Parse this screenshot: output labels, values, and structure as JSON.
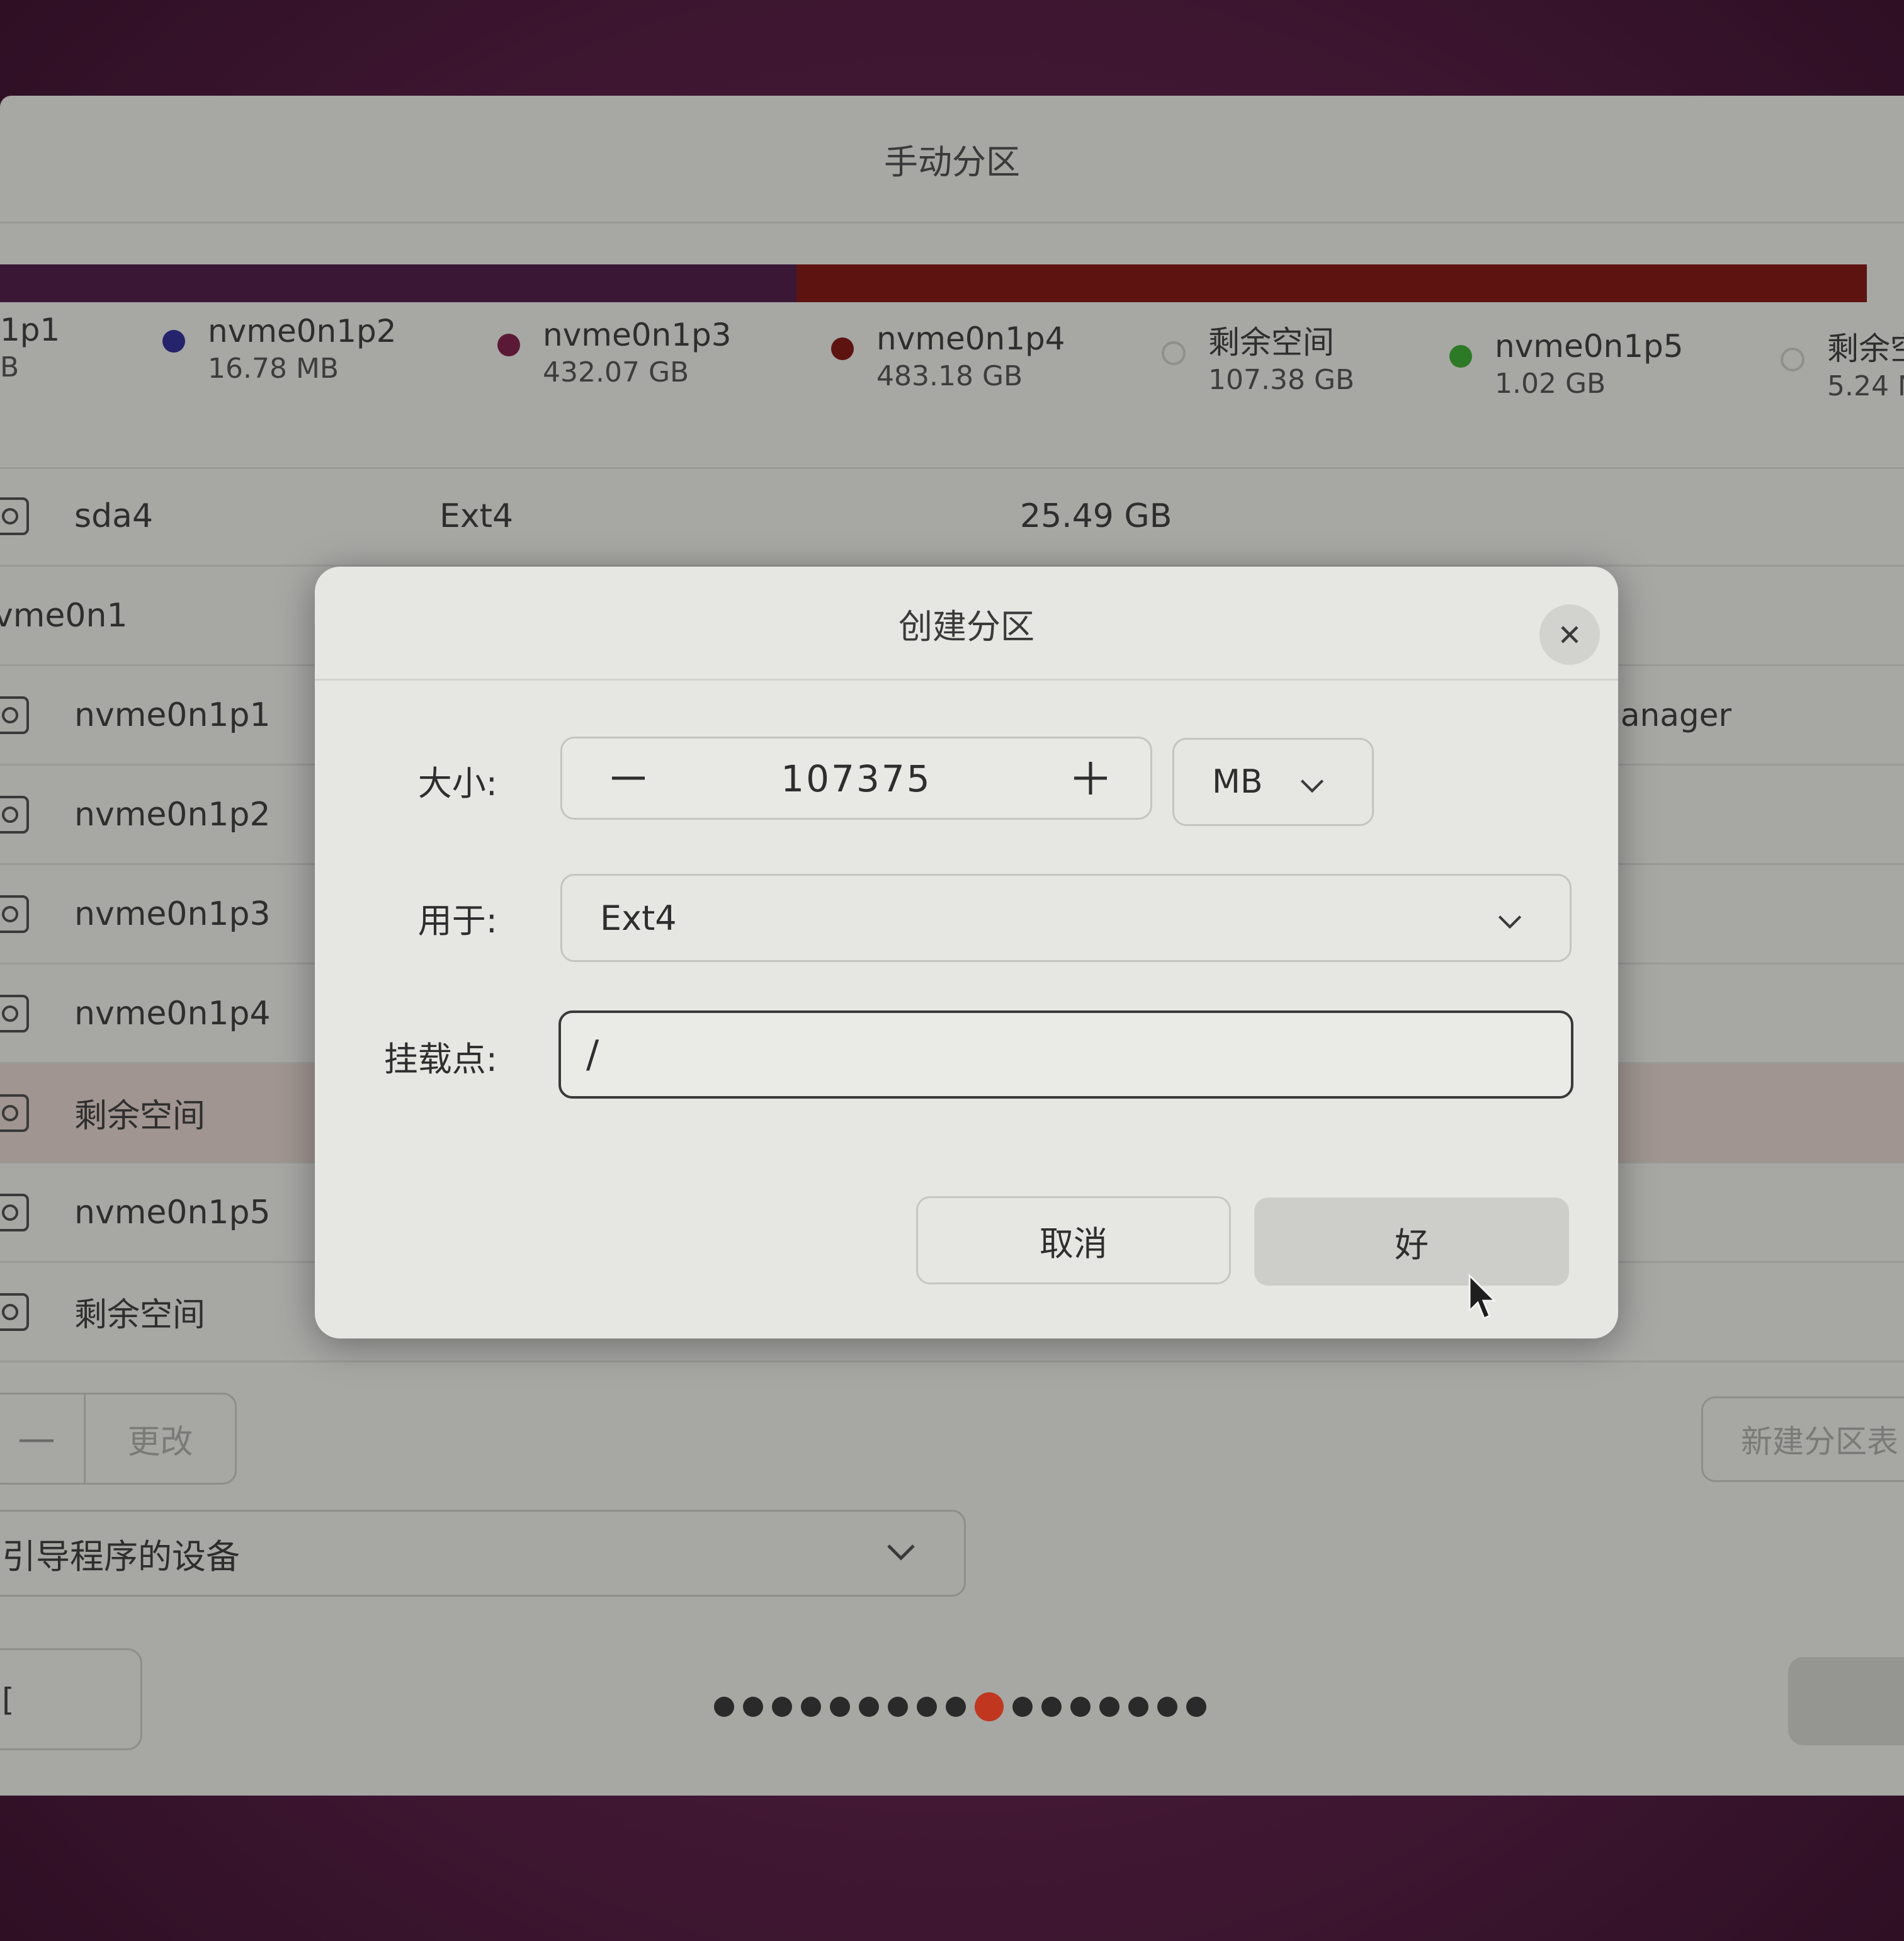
{
  "window": {
    "title": "手动分区",
    "colors": {
      "usage_purple": "#3b1736",
      "usage_red": "#5d1410"
    }
  },
  "legend": [
    {
      "name": "1p1",
      "size": "B",
      "dot_color": "#6b2a3c"
    },
    {
      "name": "nvme0n1p2",
      "size": "16.78 MB",
      "dot_color": "#25236b"
    },
    {
      "name": "nvme0n1p3",
      "size": "432.07 GB",
      "dot_color": "#5a1a36"
    },
    {
      "name": "nvme0n1p4",
      "size": "483.18 GB",
      "dot_color": "#5d1410"
    },
    {
      "name": "剩余空间",
      "size": "107.38 GB",
      "dot_color": "hollow"
    },
    {
      "name": "nvme0n1p5",
      "size": "1.02 GB",
      "dot_color": "#2d7a26"
    },
    {
      "name": "剩余空",
      "size": "5.24 M",
      "dot_color": "hollow"
    }
  ],
  "rows": [
    {
      "name": "sda4",
      "fs": "Ext4",
      "size": "25.49 GB",
      "extra": ""
    },
    {
      "name": "vme0n1",
      "fs": "",
      "size": "",
      "extra": ""
    },
    {
      "name": "nvme0n1p1",
      "fs": "",
      "size": "",
      "extra": "lanager"
    },
    {
      "name": "nvme0n1p2",
      "fs": "",
      "size": "",
      "extra": ""
    },
    {
      "name": "nvme0n1p3",
      "fs": "",
      "size": "",
      "extra": ""
    },
    {
      "name": "nvme0n1p4",
      "fs": "",
      "size": "",
      "extra": ""
    },
    {
      "name": "剩余空间",
      "fs": "",
      "size": "",
      "extra": ""
    },
    {
      "name": "nvme0n1p5",
      "fs": "",
      "size": "",
      "extra": ""
    },
    {
      "name": "剩余空间",
      "fs": "",
      "size": "",
      "extra": ""
    }
  ],
  "controls": {
    "minus_label": "—",
    "change_label": "更改",
    "new_table_label": "新建分区表",
    "boot_device_label": "引导程序的设备",
    "back_label": "[",
    "dots_total": 17,
    "dots_active_index": 9
  },
  "dialog": {
    "title": "创建分区",
    "size_label": "大小:",
    "size_value": "107375",
    "size_unit": "MB",
    "use_label": "用于:",
    "use_value": "Ext4",
    "mount_label": "挂载点:",
    "mount_value": "/",
    "cancel_label": "取消",
    "ok_label": "好"
  }
}
